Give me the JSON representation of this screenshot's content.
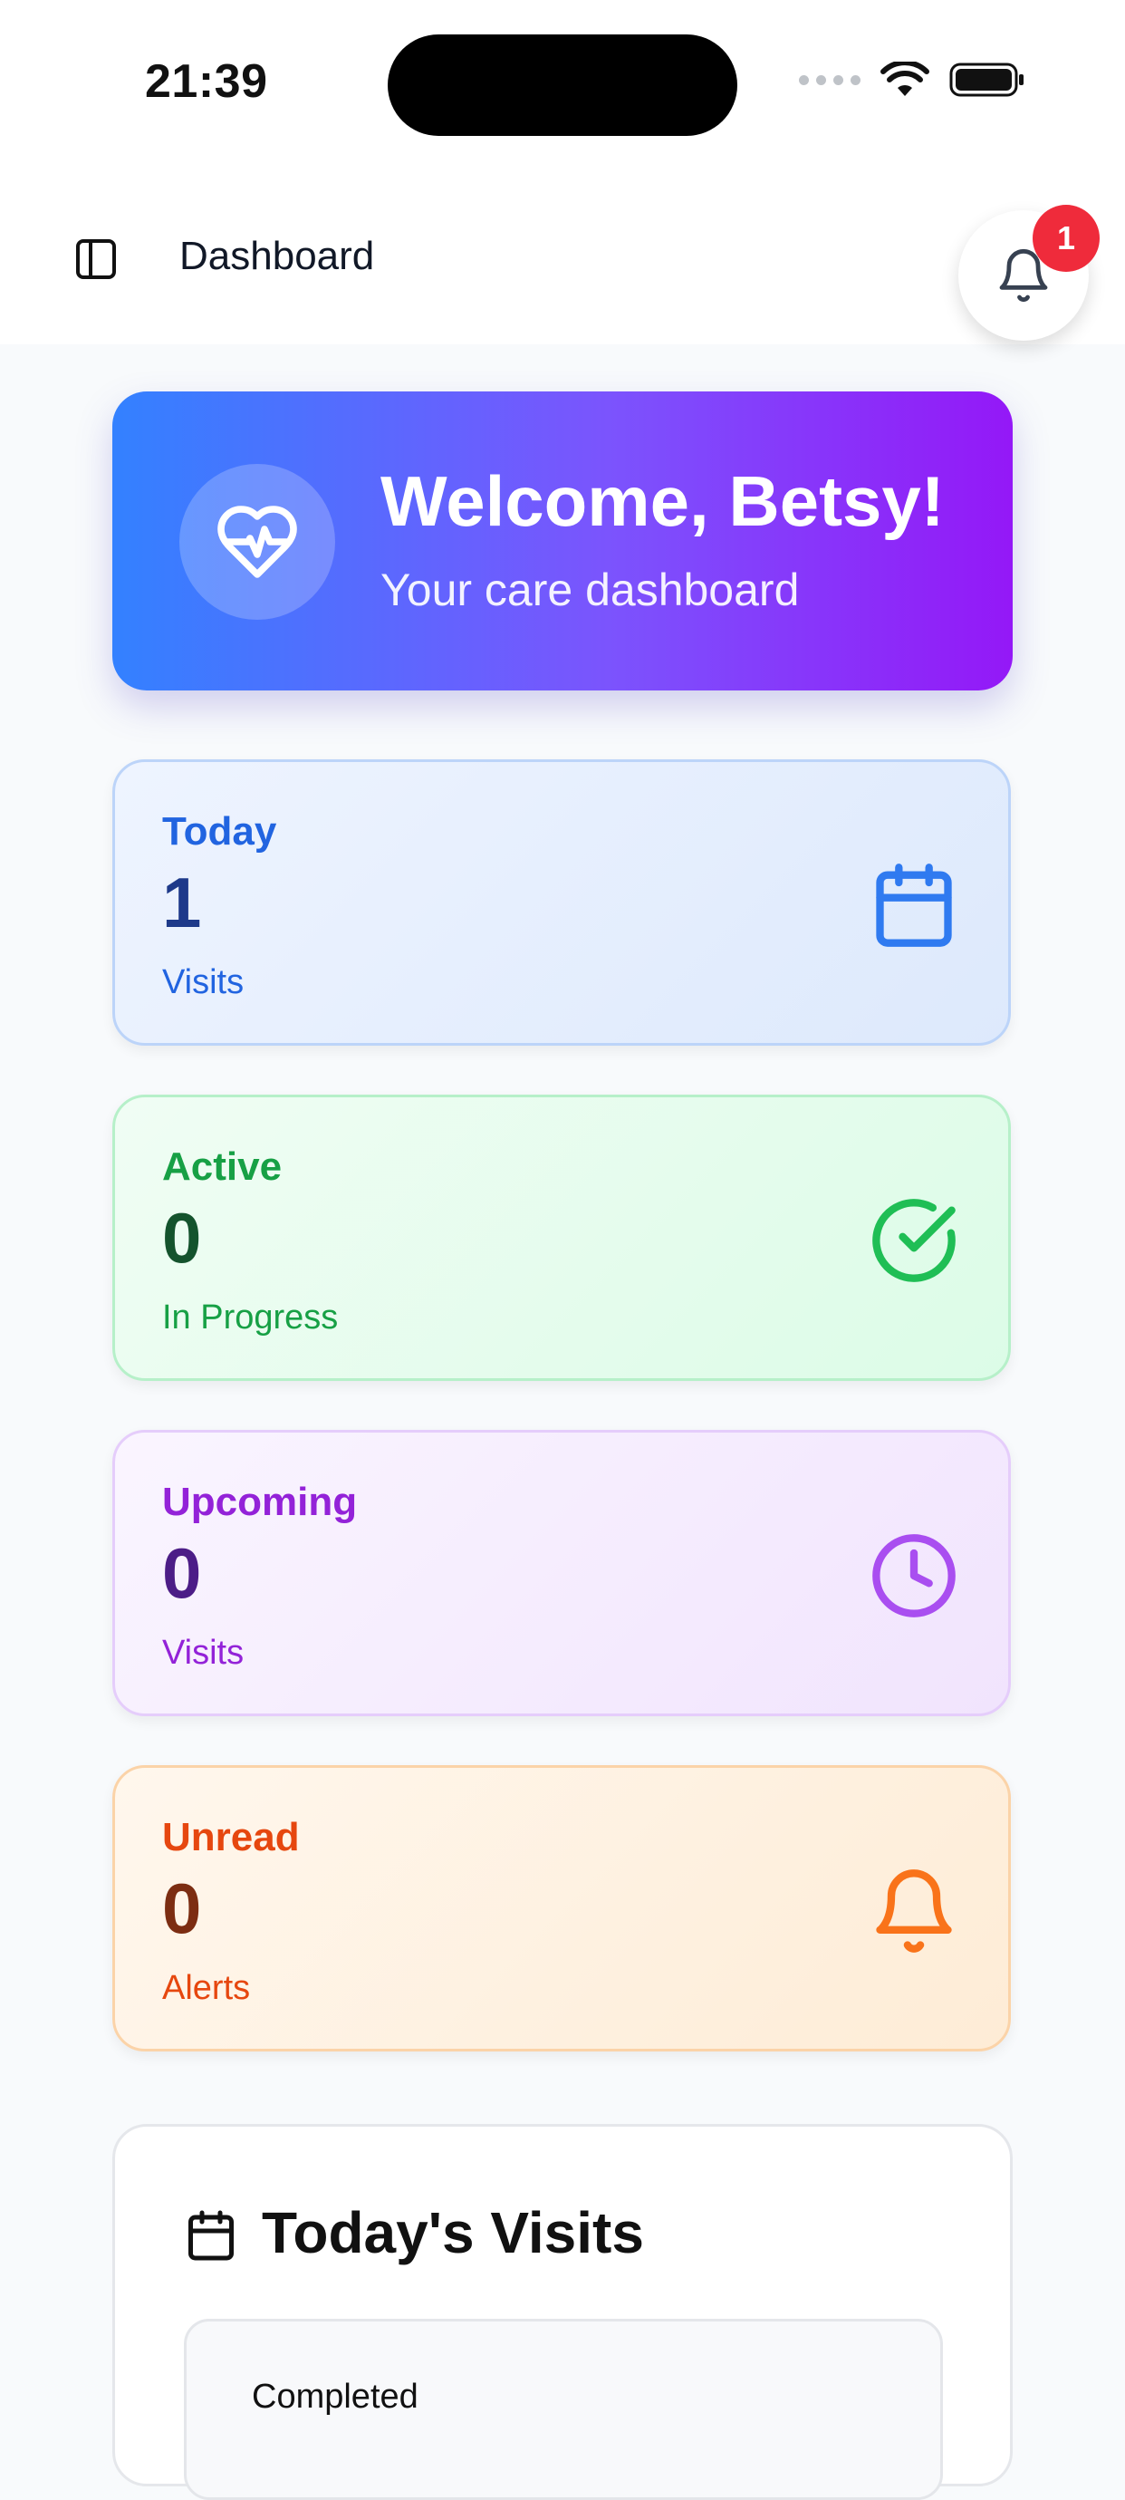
{
  "status_bar": {
    "time": "21:39"
  },
  "header": {
    "title": "Dashboard",
    "notification_count": "1"
  },
  "welcome": {
    "title": "Welcome, Betsy!",
    "subtitle": "Your care dashboard",
    "icon": "heart-pulse-icon"
  },
  "stats": {
    "today": {
      "label": "Today",
      "value": "1",
      "sub": "Visits",
      "icon": "calendar-icon",
      "color": "#2164e0"
    },
    "active": {
      "label": "Active",
      "value": "0",
      "sub": "In Progress",
      "icon": "check-circle-icon",
      "color": "#17a045"
    },
    "upcoming": {
      "label": "Upcoming",
      "value": "0",
      "sub": "Visits",
      "icon": "clock-icon",
      "color": "#9322d8"
    },
    "unread": {
      "label": "Unread",
      "value": "0",
      "sub": "Alerts",
      "icon": "bell-icon",
      "color": "#e6470f"
    }
  },
  "visits": {
    "title": "Today's Visits",
    "completed_label": "Completed"
  },
  "colors": {
    "gradient_start": "#3381ff",
    "gradient_end": "#9418f7",
    "badge": "#ef2b3b"
  }
}
